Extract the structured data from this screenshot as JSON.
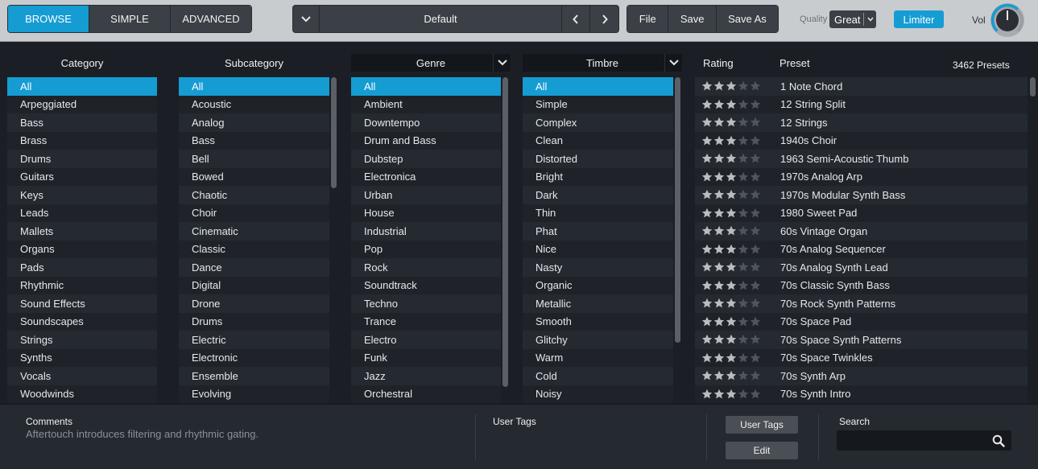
{
  "toolbar": {
    "modes": [
      "BROWSE",
      "SIMPLE",
      "ADVANCED"
    ],
    "active_mode": "BROWSE",
    "preset_name": "Default",
    "file_buttons": [
      "File",
      "Save",
      "Save As"
    ],
    "quality_label": "Quality",
    "quality_value": "Great",
    "limiter_label": "Limiter",
    "vol_label": "Vol"
  },
  "columns": {
    "category": {
      "header": "Category",
      "items": [
        "All",
        "Arpeggiated",
        "Bass",
        "Brass",
        "Drums",
        "Guitars",
        "Keys",
        "Leads",
        "Mallets",
        "Organs",
        "Pads",
        "Rhythmic",
        "Sound Effects",
        "Soundscapes",
        "Strings",
        "Synths",
        "Vocals",
        "Woodwinds"
      ],
      "selected": "All"
    },
    "subcategory": {
      "header": "Subcategory",
      "items": [
        "All",
        "Acoustic",
        "Analog",
        "Bass",
        "Bell",
        "Bowed",
        "Chaotic",
        "Choir",
        "Cinematic",
        "Classic",
        "Dance",
        "Digital",
        "Drone",
        "Drums",
        "Electric",
        "Electronic",
        "Ensemble",
        "Evolving"
      ],
      "selected": "All"
    },
    "genre": {
      "header": "Genre",
      "items": [
        "All",
        "Ambient",
        "Downtempo",
        "Drum and Bass",
        "Dubstep",
        "Electronica",
        "Urban",
        "House",
        "Industrial",
        "Pop",
        "Rock",
        "Soundtrack",
        "Techno",
        "Trance",
        "Electro",
        "Funk",
        "Jazz",
        "Orchestral"
      ],
      "selected": "All"
    },
    "timbre": {
      "header": "Timbre",
      "items": [
        "All",
        "Simple",
        "Complex",
        "Clean",
        "Distorted",
        "Bright",
        "Dark",
        "Thin",
        "Phat",
        "Nice",
        "Nasty",
        "Organic",
        "Metallic",
        "Smooth",
        "Glitchy",
        "Warm",
        "Cold",
        "Noisy"
      ],
      "selected": "All"
    }
  },
  "presets": {
    "rating_header": "Rating",
    "preset_header": "Preset",
    "count_label": "3462 Presets",
    "rows": [
      {
        "name": "1 Note Chord",
        "rating": 3
      },
      {
        "name": "12 String Split",
        "rating": 3
      },
      {
        "name": "12 Strings",
        "rating": 3
      },
      {
        "name": "1940s Choir",
        "rating": 3
      },
      {
        "name": "1963 Semi-Acoustic Thumb",
        "rating": 3
      },
      {
        "name": "1970s Analog Arp",
        "rating": 3
      },
      {
        "name": "1970s Modular Synth Bass",
        "rating": 3
      },
      {
        "name": "1980 Sweet Pad",
        "rating": 3
      },
      {
        "name": "60s Vintage Organ",
        "rating": 3
      },
      {
        "name": "70s Analog Sequencer",
        "rating": 3
      },
      {
        "name": "70s Analog Synth Lead",
        "rating": 3
      },
      {
        "name": "70s Classic Synth Bass",
        "rating": 3
      },
      {
        "name": "70s Rock Synth Patterns",
        "rating": 3
      },
      {
        "name": "70s Space Pad",
        "rating": 3
      },
      {
        "name": "70s Space Synth Patterns",
        "rating": 3
      },
      {
        "name": "70s Space Twinkles",
        "rating": 3
      },
      {
        "name": "70s Synth Arp",
        "rating": 3
      },
      {
        "name": "70s Synth Intro",
        "rating": 3
      }
    ],
    "max_rating": 5
  },
  "bottom": {
    "comments_title": "Comments",
    "comments_text": "Aftertouch introduces filtering and rhythmic gating.",
    "user_tags_title": "User Tags",
    "user_tags_button": "User Tags",
    "edit_button": "Edit",
    "search_title": "Search",
    "search_value": ""
  },
  "colors": {
    "accent": "#159cd3",
    "star_on": "#b9bcc0",
    "star_off": "#50555b"
  }
}
